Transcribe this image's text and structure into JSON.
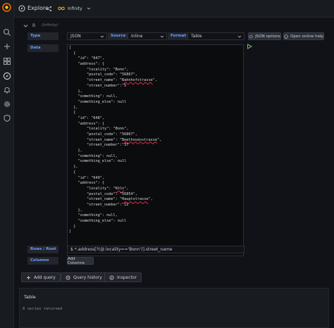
{
  "app": {
    "title": "Explore"
  },
  "datasource_picker": {
    "label": "Infinity"
  },
  "query_row": {
    "ref_id": "B",
    "datasource_hint": "(Infinity)"
  },
  "form": {
    "type_label": "Type",
    "type_value": "JSON",
    "source_label": "Source",
    "source_value": "Inline",
    "format_label": "Format",
    "format_value": "Table",
    "json_options_label": "JSON options",
    "online_help_label": "Open online help",
    "data_label": "Data",
    "rows_root_label": "Rows / Root",
    "rows_root_value": "$.*.address[?(@.locality=='Bonn')].street_name",
    "columns_label": "Columns",
    "add_columns_label": "Add Columns"
  },
  "code_lines": [
    {
      "t": "["
    },
    {
      "t": "  {"
    },
    {
      "t": "    \"id\": \"647\","
    },
    {
      "t": "    \"address\": {"
    },
    {
      "t": "        \"locality\": \"Bonn\","
    },
    {
      "t": "        \"postal_code\": \"56867\","
    },
    {
      "pre": "        \"street_name\": \"",
      "sq": "Bahnhofstrasse",
      "post": "\","
    },
    {
      "t": "        \"street_number\": 5"
    },
    {
      "t": "    },"
    },
    {
      "t": "    \"something\": null,"
    },
    {
      "t": "    \"something_else\": null"
    },
    {
      "t": "  },"
    },
    {
      "t": "  {"
    },
    {
      "t": "    \"id\": \"648\","
    },
    {
      "t": "    \"address\": {"
    },
    {
      "t": "        \"locality\": \"Bonn\","
    },
    {
      "t": "        \"postal_code\": \"56867\","
    },
    {
      "pre": "        \"street_name\": \"",
      "sq": "Beethovenstrasse",
      "post": "\","
    },
    {
      "t": "        \"street_number\": 37"
    },
    {
      "t": "    },"
    },
    {
      "t": "    \"something\": null,"
    },
    {
      "t": "    \"something_else\": null"
    },
    {
      "t": "  },"
    },
    {
      "t": "  {"
    },
    {
      "t": "    \"id\": \"649\","
    },
    {
      "t": "    \"address\": {"
    },
    {
      "pre": "        \"locality\": \"",
      "sq": "Köln",
      "post": "\","
    },
    {
      "t": "        \"postal_code\": \"56854\","
    },
    {
      "pre": "        \"street_name\": \"",
      "sq": "Hauptstrasse",
      "post": "\","
    },
    {
      "t": "        \"street_number\": 12"
    },
    {
      "t": "    },"
    },
    {
      "t": "    \"something\": null,"
    },
    {
      "t": "    \"something_else\": null"
    },
    {
      "t": "  }"
    },
    {
      "t": "]"
    }
  ],
  "toolbar": {
    "add_query_label": "Add query",
    "query_history_label": "Query history",
    "inspector_label": "Inspector"
  },
  "results": {
    "panel_title": "Table",
    "message": "0 series returned"
  },
  "colors": {
    "accent_blue": "#6e9fff",
    "run_green": "#73bf69",
    "brand_orange": "#f46800",
    "error_squiggle": "#e02f44"
  },
  "icons": [
    "grafana-logo-icon",
    "search-icon",
    "plus-icon",
    "dashboards-icon",
    "explore-icon",
    "alerting-icon",
    "gear-icon",
    "shield-icon",
    "compass-icon",
    "share-icon",
    "infinity-icon",
    "chevron-down-icon",
    "run-query-icon"
  ]
}
